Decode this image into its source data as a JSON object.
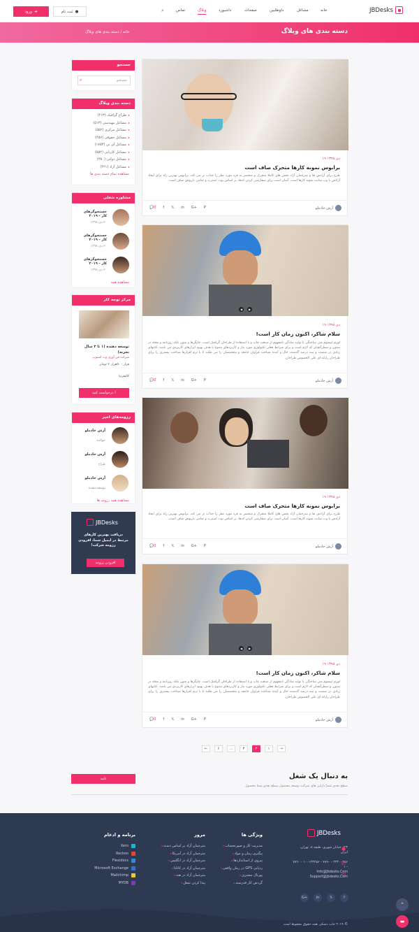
{
  "header": {
    "logo_text": "JBDesks",
    "nav": [
      "خانه",
      "مشاغل",
      "داوطلبین",
      "صفحات",
      "داشبورد",
      "وبلاگ",
      "تماس"
    ],
    "active_nav": "وبلاگ",
    "login_label": "ورود",
    "register_label": "ثبت نام"
  },
  "banner": {
    "title": "دسته بندی های وبلاگ",
    "breadcrumb_home": "خانه",
    "breadcrumb_sep": "/",
    "breadcrumb_current": "دسته بندی های وبلاگ"
  },
  "sidebar": {
    "search": {
      "title": "جستجو",
      "placeholder": "جستجو"
    },
    "categories": {
      "title": "دسته بندی وبلاگ",
      "items": [
        "طراح گرافیک (۲۱۳)",
        "مشاغل مهندسی (۵۱۳)",
        "مشاغل مرکزی (۵۵۲)",
        "مشاغل حقوقی (۴۵۷)",
        "مشاغل آی تی (۱۷۵۳)",
        "مشاغل کاریابی (۵۵۲)",
        "مشاغل دولتی (۳۵۰)",
        "مشاغل آزاد (۴۲۱)"
      ],
      "more": "مشاهده تمام دسته بندی ها"
    },
    "career": {
      "title": "مشاوره شغلی",
      "items": [
        {
          "title": "جستجوگرهای کار - ۲۰۱۹",
          "date": "۲۰ دی ۱۳۹۸"
        },
        {
          "title": "جستجوگرهای کار - ۲۰۱۹",
          "date": "۲۰ دی ۱۳۹۸"
        },
        {
          "title": "جستجوگرهای کار - ۲۰۱۹",
          "date": "۲۰ دی ۱۳۹۸"
        }
      ],
      "more": "مشاهده همه"
    },
    "featured": {
      "title": "مرکز توجه کار",
      "job_title": "توسعه دهنده (۱ تا ۳ سال تجربه)",
      "company": "شرکت فن آوری وب اسنوپ",
      "salary": "هزار - ۵۰هزار۲۰ تومان",
      "location": "کالیفرنیا",
      "apply": "درخواست کنید !"
    },
    "resumes": {
      "title": "رزومه‌های اخیر",
      "items": [
        {
          "name": "آرش خادملو",
          "role": "حوالده"
        },
        {
          "name": "آرش خادملو",
          "role": "طراح"
        },
        {
          "name": "آرش خادملو",
          "role": "توسعه دهنده"
        }
      ],
      "more": "مشاهده همه رزومه ها"
    },
    "promo": {
      "logo": "JBDesks",
      "text": "دریافت بهترین کارهای مرتبط در ایمیل شما، افزودن رزومه شرکت!",
      "button": "افزودن رزومه"
    }
  },
  "posts": [
    {
      "date": "۱۹ دی ۱۳۹۸",
      "title": "برابوس نمونه کارها متحرک صاف است",
      "body": "طرح برای آزادس ها و مترجمان آزاد بخش های کاملا متحرک و منحصر به فرد مورد نظر را جذاب تر می کند. برابوس بهترین راه برای ایجاد آزادس با وب سایت نمونه کارها است. آسان است برای سفارشی کردن کدها، بر اساس بوت استرپ و تمامی یارپوش صاف است.",
      "author": "آرش خادملو",
      "comments": "0"
    },
    {
      "date": "۱۹ دی ۱۳۹۸",
      "title": "سلام شاکر، اکنون زمان کار است!",
      "body": "لورم ایپسوم متن ساختگی با تولید سادگی نامفهوم از صنعت چاپ و با استفاده از طراحان گرافیک است. چاپگرها و متون بلکه روزنامه و مجله در ستون و سطرآنچنان که لازم است و برای شرایط فعلی تکنولوژی مورد نیاز و کاربردهای متنوع با هدف بهبود ابزارهای کاربردی می باشد. کتابهای زیادی در شصت و سه درصد گذشته، حال و آینده شناخت فراوان جامعه و متخصصان را می طلبد تا با نرم افزارها شناخت بیشتری را برای طراحان رایانه ای علی الخصوص طراحان.",
      "author": "آرش خادملو",
      "comments": "0"
    },
    {
      "date": "۱۹ دی ۱۳۹۸",
      "title": "برابوس نمونه کارها متحرک صاف است",
      "body": "طرح برای آزادس ها و مترجمان آزاد بخش های کاملا متحرک و منحصر به فرد مورد نظر را جذاب تر می کند. برابوس بهترین راه برای ایجاد آزادس با وب سایت نمونه کارها است. آسان است برای سفارشی کردن کدها، بر اساس بوت استرپ و تمامی یارپوش صاف است.",
      "author": "آرش خادملو",
      "comments": "0"
    },
    {
      "date": "۱۹ دی ۱۳۹۸",
      "title": "سلام شاکر، اکنون زمان کار است!",
      "body": "لورم ایپسوم متن ساختگی با تولید سادگی نامفهوم از صنعت چاپ و با استفاده از طراحان گرافیک است. چاپگرها و متون بلکه روزنامه و مجله در ستون و سطرآنچنان که لازم است و برای شرایط فعلی تکنولوژی مورد نیاز و کاربردهای متنوع با هدف بهبود ابزارهای کاربردی می باشد. کتابهای زیادی در شصت و سه درصد گذشته، حال و آینده شناخت فراوان جامعه و متخصصان را می طلبد تا با نرم افزارها شناخت بیشتری را برای طراحان رایانه ای علی الخصوص طراحان.",
      "author": "آرش خادملو",
      "comments": "0"
    }
  ],
  "share_icons": [
    "f",
    "𝕏",
    "in",
    "G+",
    "P"
  ],
  "pagination": {
    "prev": "←",
    "pages": [
      "۱",
      "۲",
      "۳",
      "...",
      "۶"
    ],
    "active": "۲",
    "next": "→"
  },
  "job_alert": {
    "heading": "به دنبال یک شغل",
    "sub": "سطح بعدی شما دارایی های شرکت توسعه محصول سطح بعدی شما محصول",
    "button": "تایید"
  },
  "footer": {
    "logo": "JBDesks",
    "address": "۱۲۳ خیابان شهری، طبقه ۸، تهران، ایران",
    "phones": "۲۳۲۰۰۴۵۶ - ۷۸۹۰ - ۱۰۰۱۲۳۴۵۶ - ۷۸۹۰ - ۱",
    "emails": "Info@Jbdesks.Com Support@jbdesks.Com",
    "features_title": "ویژگی ها",
    "features": [
      "مدیریت کار و صورتحساب",
      "پیگیری زمان و مواد",
      "پیروی از استانداردها",
      "ردیابی GPS در زمان واقعی",
      "پورتال مشتری",
      "گردش کار قدرتمند"
    ],
    "browse_title": "مرور",
    "browse": [
      "مترجمان آزاد بر اساس دسته",
      "مترجمان آزاد در آمریکا",
      "مترجمان آزاد در انگلیس",
      "مترجمان آزاد در کانادا",
      "مترجمان آزاد در هند",
      "پیدا کردن شغل"
    ],
    "apps_title": "برنامه و ادغام",
    "apps": [
      "Xero",
      "Reckon",
      "Flexidocs",
      "Microsoft Exchange",
      "Mailchimp",
      "MYOB"
    ],
    "app_colors": [
      "#1ab4d7",
      "#e8452c",
      "#2c8ad8",
      "#3a6fcf",
      "#f7c62f",
      "#7d3cb5"
    ],
    "copyright": "© ۲۰۱۹ جاب دسکز، همه حقوق محفوظ است"
  }
}
